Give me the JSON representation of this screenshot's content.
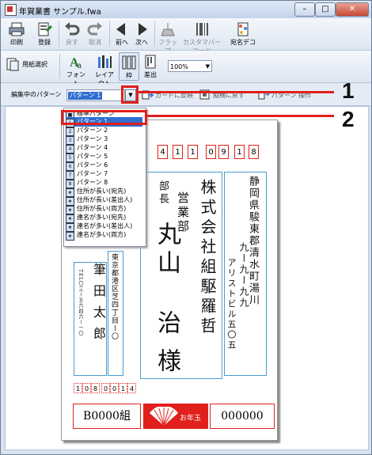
{
  "window": {
    "title": "年賀業書 サンプル.fwa",
    "min": "–",
    "max": "□",
    "close": "✕"
  },
  "toolbar1": {
    "print": "印刷",
    "register": "登録",
    "undo": "戻す",
    "cancel": "取消",
    "prev": "前へ",
    "next": "次へ",
    "flap": "フラップ",
    "custombarcode": "カスタマバーコード",
    "addressdeco": "宛名デコ"
  },
  "toolbar2": {
    "paper": "用紙選択",
    "font": "フォント",
    "layout": "レイアウト",
    "frame": "枠",
    "sender": "差出",
    "zoom": "100%"
  },
  "pattern": {
    "label": "編集中のパターン",
    "selected": "パターン 1",
    "tool1": "カードに反映",
    "tool2": "縦横に戻す",
    "tool3": "パターン 操作"
  },
  "callouts": {
    "one": "1",
    "two": "2"
  },
  "dropdown": {
    "items": [
      {
        "icon": "■",
        "label": "標準パターン"
      },
      {
        "icon": "1",
        "label": "パターン 1"
      },
      {
        "icon": "2",
        "label": "パターン 2"
      },
      {
        "icon": "3",
        "label": "パターン 3"
      },
      {
        "icon": "4",
        "label": "パターン 4"
      },
      {
        "icon": "5",
        "label": "パターン 5"
      },
      {
        "icon": "6",
        "label": "パターン 6"
      },
      {
        "icon": "7",
        "label": "パターン 7"
      },
      {
        "icon": "8",
        "label": "パターン 8"
      },
      {
        "icon": "★",
        "label": "住所が長い(宛先)"
      },
      {
        "icon": "★",
        "label": "住所が長い(差出人)"
      },
      {
        "icon": "★",
        "label": "住所が長い(両方)"
      },
      {
        "icon": "★",
        "label": "連名が多い(宛先)"
      },
      {
        "icon": "★",
        "label": "連名が多い(差出人)"
      },
      {
        "icon": "★",
        "label": "連名が多い(両方)"
      }
    ]
  },
  "card": {
    "zip": [
      "4",
      "1",
      "1",
      "0",
      "9",
      "1",
      "8"
    ],
    "address1": "静岡県駿東郡清水町湯川",
    "address2": "九ー九ー九九",
    "address3": "アリストビル五〇五",
    "company": "株式会社組駆羅哲",
    "dept": "営業部",
    "title": "部長",
    "name1": "丸山",
    "name2": "治",
    "honorific": "様",
    "sender_address": "東京都港区芝四丁目ー〇",
    "sender_phone": "TEL〇三ー五六四六ー一〇",
    "sender_name": "筆田太郎",
    "sender_zip": [
      "1",
      "0",
      "8",
      "0",
      "0",
      "1",
      "4"
    ],
    "lottery_left": "B0000組",
    "lottery_mid": "お年玉",
    "lottery_right": "000000"
  }
}
